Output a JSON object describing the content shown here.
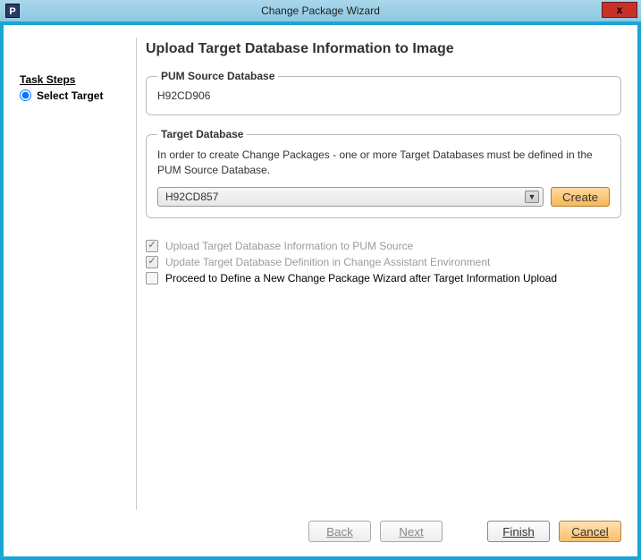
{
  "window": {
    "title": "Change Package Wizard",
    "appIconLetter": "P",
    "closeGlyph": "x"
  },
  "sidebar": {
    "stepsTitle": "Task Steps",
    "items": [
      {
        "label": "Select Target",
        "selected": true
      }
    ]
  },
  "page": {
    "title": "Upload Target Database Information to Image"
  },
  "pumSource": {
    "legend": "PUM Source Database",
    "value": "H92CD906"
  },
  "targetDb": {
    "legend": "Target Database",
    "description": "In order to create Change Packages - one or more Target Databases must be defined in the PUM Source Database.",
    "selected": "H92CD857",
    "createLabel": "Create"
  },
  "options": [
    {
      "label": "Upload Target Database Information to PUM Source",
      "checked": true,
      "disabled": true
    },
    {
      "label": "Update Target Database Definition in Change Assistant Environment",
      "checked": true,
      "disabled": true
    },
    {
      "label": "Proceed to Define a New Change Package Wizard after Target Information Upload",
      "checked": false,
      "disabled": false
    }
  ],
  "footer": {
    "back": "Back",
    "next": "Next",
    "finish": "Finish",
    "cancel": "Cancel"
  }
}
